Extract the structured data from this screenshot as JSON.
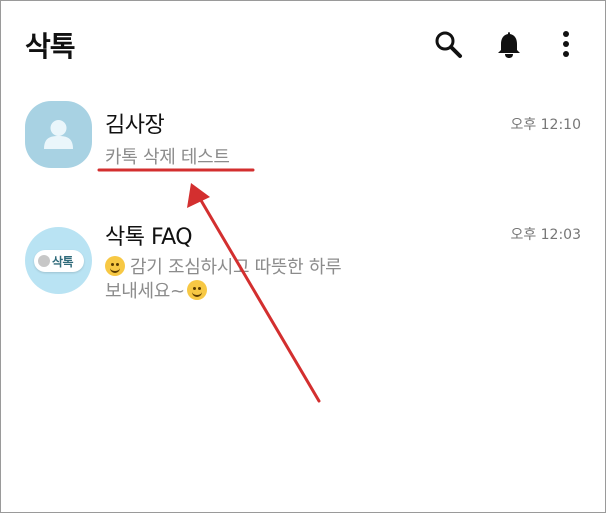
{
  "header": {
    "title": "삭톡",
    "icons": [
      "search-icon",
      "bell-icon",
      "more-icon"
    ]
  },
  "chats": [
    {
      "name": "김사장",
      "time": "오후 12:10",
      "preview": "카톡 삭제 테스트",
      "avatar": "default-person-avatar"
    },
    {
      "name": "삭톡 FAQ",
      "time": "오후 12:03",
      "preview_line_1": "감기 조심하시고 따뜻한 하루",
      "preview_line_2": "보내세요~",
      "avatar_label": "삭톡",
      "avatar": "speech-bubble-avatar"
    }
  ],
  "colors": {
    "annotation": "#d32f2f",
    "avatar": "#a8d2e3",
    "secondary_text": "#8c8c8c"
  }
}
